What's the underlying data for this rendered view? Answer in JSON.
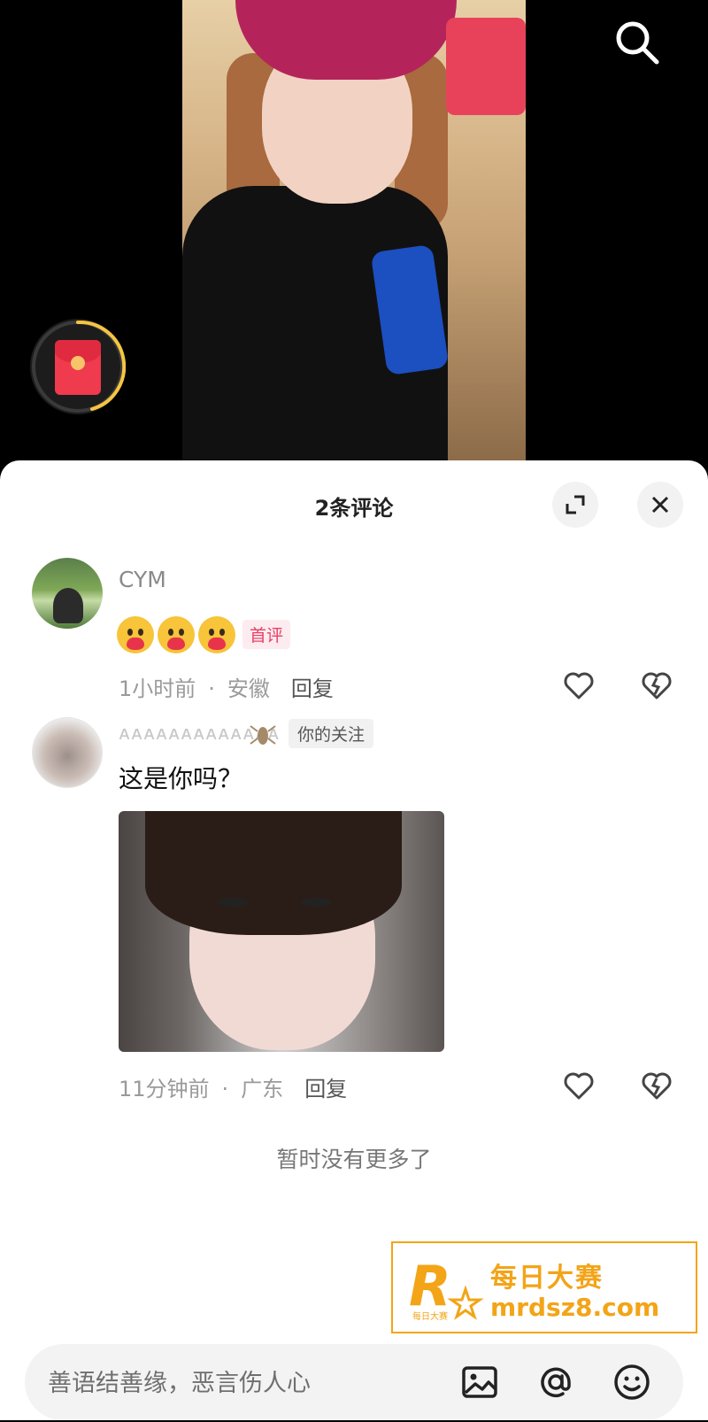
{
  "header": {
    "comment_count_title": "2条评论"
  },
  "comments": [
    {
      "username": "CYM",
      "first_badge": "首评",
      "time": "1小时前",
      "location": "安徽",
      "reply_label": "回复"
    },
    {
      "username_masked": "ᴀᴀᴀᴀᴀᴀᴀᴀᴀᴀᴀᴀᴀ",
      "follow_badge": "你的关注",
      "text": "这是你吗？",
      "time": "11分钟前",
      "location": "广东",
      "reply_label": "回复"
    }
  ],
  "footer_note": "暂时没有更多了",
  "watermark": {
    "logo_letter": "R",
    "logo_small": "每日大赛",
    "title": "每日大赛",
    "url": "mrdsz8.com"
  },
  "input": {
    "placeholder": "善语结善缘，恶言伤人心"
  },
  "icons": {
    "search": "search-icon",
    "redpacket": "red-envelope-icon",
    "expand": "expand-icon",
    "close": "close-icon",
    "like": "heart-icon",
    "dislike": "broken-heart-icon",
    "image": "image-icon",
    "mention": "at-icon",
    "emoji": "emoji-icon"
  },
  "colors": {
    "accent_pink": "#e83e66",
    "watermark_orange": "#f3a417",
    "progress_ring": "#f5c542"
  }
}
